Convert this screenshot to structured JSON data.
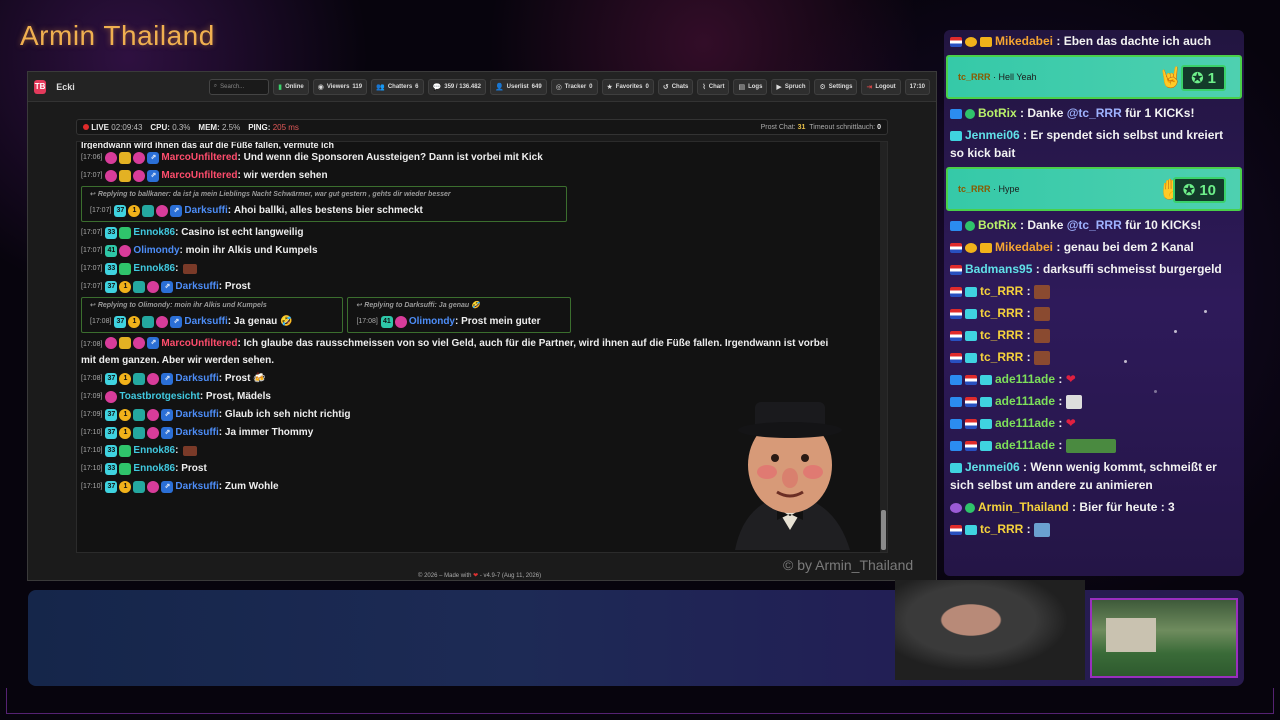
{
  "overlay": {
    "brand": "Armin Thailand",
    "watermark": "© by Armin_Thailand"
  },
  "app": {
    "logo": "TB",
    "name": "Ecki",
    "search_placeholder": "Search...",
    "toolbar": [
      {
        "icon": "signal-icon",
        "label": "Online"
      },
      {
        "icon": "eye-icon",
        "label": "Viewers",
        "count": "119"
      },
      {
        "icon": "users-icon",
        "label": "Chatters",
        "count": "6"
      },
      {
        "icon": "chat-icon",
        "label": "359 / 136.482"
      },
      {
        "icon": "user-icon",
        "label": "Userlist",
        "count": "649"
      },
      {
        "icon": "target-icon",
        "label": "Tracker",
        "count": "0"
      },
      {
        "icon": "star-icon",
        "label": "Favorites",
        "count": "0"
      },
      {
        "icon": "history-icon",
        "label": "Chats"
      },
      {
        "icon": "chart-icon",
        "label": "Chart"
      },
      {
        "icon": "logs-icon",
        "label": "Logs"
      },
      {
        "icon": "speech-icon",
        "label": "Spruch"
      },
      {
        "icon": "gear-icon",
        "label": "Settings"
      },
      {
        "icon": "logout-icon",
        "label": "Logout"
      }
    ],
    "clock": "17:10",
    "status": {
      "live_label": "LIVE",
      "live_time": "02:09:43",
      "cpu_label": "CPU:",
      "cpu": "0.3%",
      "mem_label": "MEM:",
      "mem": "2.5%",
      "ping_label": "PING:",
      "ping": "205 ms",
      "prost_label": "Prost Chat:",
      "prost": "31",
      "timeout_label": "Timeout schnittlauch:",
      "timeout": "0"
    },
    "footer": "© 2026 – Made with",
    "footer_version": "- v4.9-7 (Aug 11, 2026)"
  },
  "chat": {
    "cut_line": "Irgendwann wird ihnen das auf die Füße fallen, vermute ich",
    "messages": [
      {
        "time": "[17:06]",
        "user": "MarcoUnfiltered",
        "text": "Und wenn die Sponsoren Aussteigen? Dann ist vorbei mit Kick"
      },
      {
        "time": "[17:07]",
        "user": "MarcoUnfiltered",
        "text": "wir werden sehen"
      },
      {
        "reply": "Replying to ballkaner: da ist ja mein Lieblings Nacht Schwärmer, war gut gestern , gehts dir wieder besser",
        "time": "[17:07]",
        "user": "Darksuffi",
        "text": "Ahoi ballki, alles bestens bier schmeckt"
      },
      {
        "time": "[17:07]",
        "user": "Ennok86",
        "text": "Casino ist echt langweilig"
      },
      {
        "time": "[17:07]",
        "user": "Olimondy",
        "text": "moin ihr Alkis und Kumpels"
      },
      {
        "time": "[17:07]",
        "user": "Ennok86",
        "text": ""
      },
      {
        "time": "[17:07]",
        "user": "Darksuffi",
        "text": "Prost"
      },
      {
        "reply": "Replying to Olimondy: moin ihr Alkis und Kumpels",
        "time": "[17:08]",
        "user": "Darksuffi",
        "text": "Ja genau 🤣"
      },
      {
        "reply": "Replying to Darksuffi: Ja genau 🤣",
        "time": "[17:08]",
        "user": "Olimondy",
        "text": "Prost mein guter"
      },
      {
        "time": "[17:08]",
        "user": "MarcoUnfiltered",
        "text": "Ich glaube das rausschmeissen von so viel Geld, auch für die Partner, wird ihnen auf die Füße fallen. Irgendwann ist vorbei mit dem ganzen. Aber wir werden sehen."
      },
      {
        "time": "[17:08]",
        "user": "Darksuffi",
        "text": "Prost 🍻"
      },
      {
        "time": "[17:09]",
        "user": "Toastbrotgesicht",
        "text": "Prost, Mädels"
      },
      {
        "time": "[17:09]",
        "user": "Darksuffi",
        "text": "Glaub ich seh nicht richtig"
      },
      {
        "time": "[17:10]",
        "user": "Darksuffi",
        "text": "Ja immer Thommy"
      },
      {
        "time": "[17:10]",
        "user": "Ennok86",
        "text": ""
      },
      {
        "time": "[17:10]",
        "user": "Ennok86",
        "text": "Prost"
      },
      {
        "time": "[17:10]",
        "user": "Darksuffi",
        "text": "Zum Wohle"
      }
    ]
  },
  "side_chat": {
    "m0": {
      "user": "Mikedabei",
      "text": "Eben das dachte ich auch"
    },
    "kick1": {
      "user": "tc_RRR",
      "note": "Hell Yeah",
      "amount": "1"
    },
    "m1": {
      "user": "BotRix",
      "text_a": "Danke",
      "mention": "@tc_RRR",
      "text_b": "für 1 KICKs!"
    },
    "m2": {
      "user": "Jenmei06",
      "text": "Er spendet sich selbst und kreiert so kick bait"
    },
    "kick2": {
      "user": "tc_RRR",
      "note": "Hype",
      "amount": "10"
    },
    "m3": {
      "user": "BotRix",
      "text_a": "Danke",
      "mention": "@tc_RRR",
      "text_b": "für 10 KICKs!"
    },
    "m4": {
      "user": "Mikedabei",
      "text": "genau bei dem 2 Kanal"
    },
    "m5": {
      "user": "Badmans95",
      "text": "darksuffi schmeisst burgergeld"
    },
    "m6": {
      "user": "tc_RRR"
    },
    "m7": {
      "user": "tc_RRR"
    },
    "m8": {
      "user": "tc_RRR"
    },
    "m9": {
      "user": "tc_RRR"
    },
    "m10": {
      "user": "ade111ade"
    },
    "m11": {
      "user": "ade111ade"
    },
    "m12": {
      "user": "ade111ade"
    },
    "m13": {
      "user": "ade111ade"
    },
    "m14": {
      "user": "Jenmei06",
      "text": "Wenn wenig kommt, schmeißt er sich selbst um andere zu animieren"
    },
    "m15": {
      "user": "Armin_Thailand",
      "text": "Bier für heute : 3"
    },
    "m16": {
      "user": "tc_RRR"
    }
  }
}
